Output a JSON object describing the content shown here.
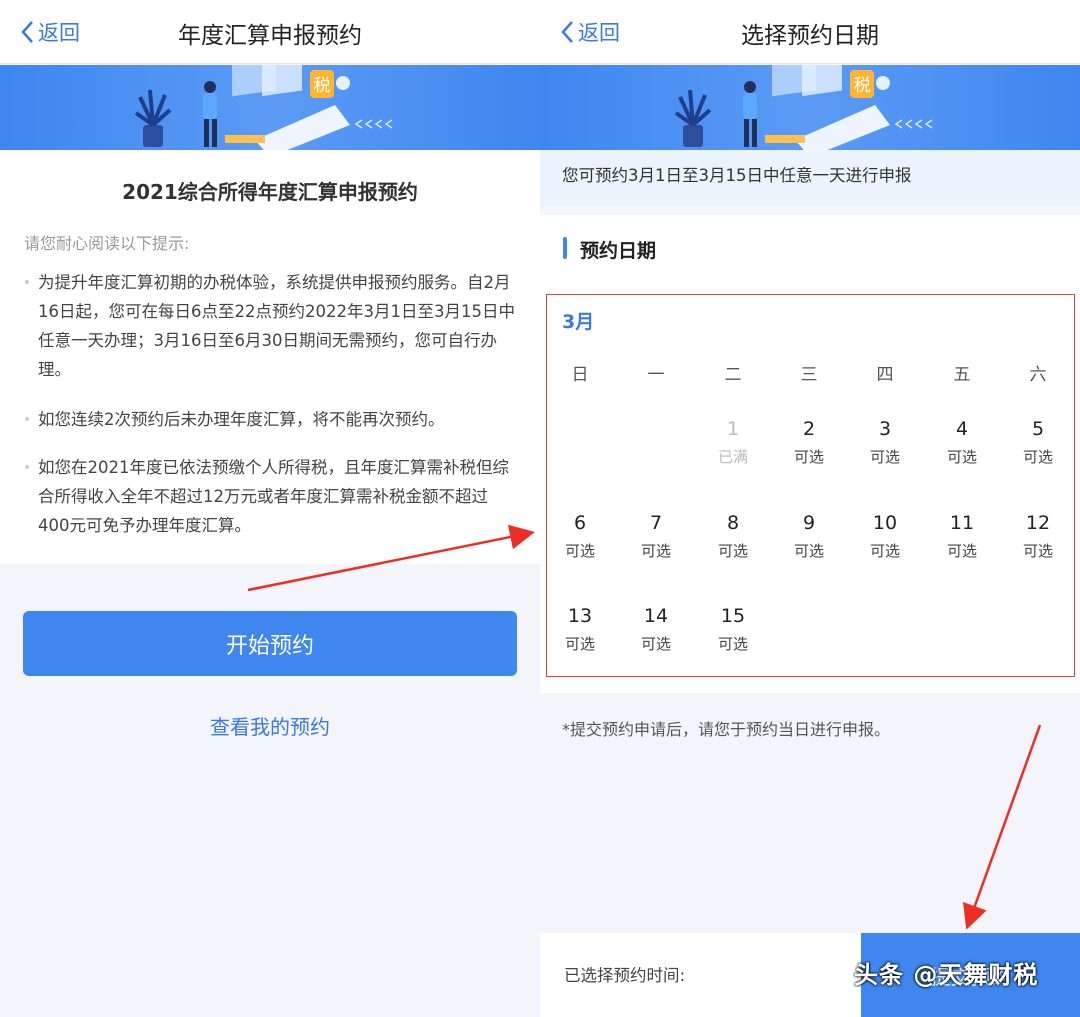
{
  "left": {
    "back_label": "返回",
    "title": "年度汇算申报预约",
    "card_title": "2021综合所得年度汇算申报预约",
    "hint": "请您耐心阅读以下提示:",
    "bullets": [
      "为提升年度汇算初期的办税体验，系统提供申报预约服务。自2月16日起，您可在每日6点至22点预约2022年3月1日至3月15日中任意一天办理；3月16日至6月30日期间无需预约，您可自行办理。",
      "如您连续2次预约后未办理年度汇算，将不能再次预约。",
      "如您在2021年度已依法预缴个人所得税，且年度汇算需补税但综合所得收入全年不超过12万元或者年度汇算需补税金额不超过400元可免予办理年度汇算。"
    ],
    "start_button": "开始预约",
    "my_link": "查看我的预约",
    "tax_badge": "税"
  },
  "right": {
    "back_label": "返回",
    "title": "选择预约日期",
    "tax_badge": "税",
    "notice": "您可预约3月1日至3月15日中任意一天进行申报",
    "section_title": "预约日期",
    "month": "3月",
    "weekdays": [
      "日",
      "一",
      "二",
      "三",
      "四",
      "五",
      "六"
    ],
    "days": [
      {
        "n": "1",
        "s": "已满"
      },
      {
        "n": "2",
        "s": "可选"
      },
      {
        "n": "3",
        "s": "可选"
      },
      {
        "n": "4",
        "s": "可选"
      },
      {
        "n": "5",
        "s": "可选"
      },
      {
        "n": "6",
        "s": "可选"
      },
      {
        "n": "7",
        "s": "可选"
      },
      {
        "n": "8",
        "s": "可选"
      },
      {
        "n": "9",
        "s": "可选"
      },
      {
        "n": "10",
        "s": "可选"
      },
      {
        "n": "11",
        "s": "可选"
      },
      {
        "n": "12",
        "s": "可选"
      },
      {
        "n": "13",
        "s": "可选"
      },
      {
        "n": "14",
        "s": "可选"
      },
      {
        "n": "15",
        "s": "可选"
      }
    ],
    "foot_note": "*提交预约申请后，请您于预约当日进行申报。",
    "selected_label": "已选择预约时间:",
    "submit_button": "提交预约"
  },
  "watermark": "头条 @天舞财税",
  "colors": {
    "accent": "#3f87ee",
    "highlight": "#e8413c"
  }
}
